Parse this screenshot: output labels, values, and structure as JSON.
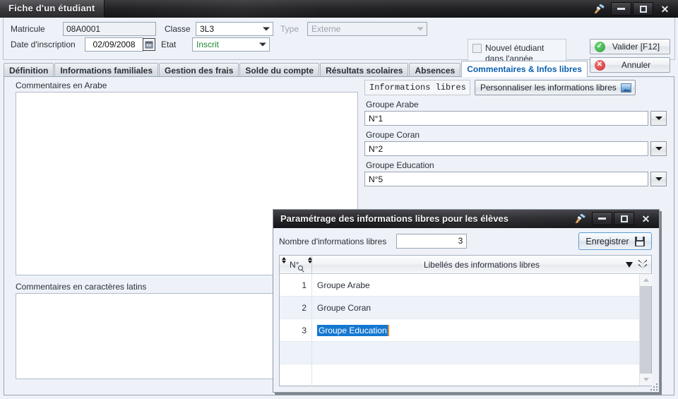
{
  "window": {
    "title": "Fiche d'un étudiant",
    "buttons": {
      "brush": "brush-icon",
      "minimize": "–",
      "maximize": "□",
      "close": "✕"
    }
  },
  "header_form": {
    "matricule_label": "Matricule",
    "matricule_value": "08A0001",
    "classe_label": "Classe",
    "classe_value": "3L3",
    "type_label": "Type",
    "type_value": "Externe",
    "date_label": "Date d'inscription",
    "date_value": "02/09/2008",
    "etat_label": "Etat",
    "etat_value": "Inscrit",
    "etat_color": "#1a8a2e",
    "checkbox_label": "Nouvel étudiant dans l'année courante",
    "valider_label": "Valider [F12]",
    "annuler_label": "Annuler"
  },
  "tabs": [
    {
      "label": "Définition",
      "active": false
    },
    {
      "label": "Informations familiales",
      "active": false
    },
    {
      "label": "Gestion des frais",
      "active": false
    },
    {
      "label": "Solde du compte",
      "active": false
    },
    {
      "label": "Résultats scolaires",
      "active": false
    },
    {
      "label": "Absences",
      "active": false
    },
    {
      "label": "Commentaires & Infos libres",
      "active": true
    }
  ],
  "left_panel": {
    "arabic_label": "Commentaires en Arabe",
    "arabic_value": "",
    "latin_label": "Commentaires en caractères latins",
    "latin_value": ""
  },
  "right_panel": {
    "section_title": "Informations libres",
    "customize_button": "Personnaliser les informations libres",
    "fields": [
      {
        "label": "Groupe Arabe",
        "value": "N°1"
      },
      {
        "label": "Groupe Coran",
        "value": "N°2"
      },
      {
        "label": "Groupe Education",
        "value": "N°5"
      }
    ]
  },
  "modal": {
    "title": "Paramétrage des informations libres pour les élèves",
    "count_label": "Nombre d'informations libres",
    "count_value": "3",
    "save_label": "Enregistrer",
    "columns": {
      "num": "N°",
      "label": "Libellés des informations libres"
    },
    "rows": [
      {
        "num": "1",
        "label": "Groupe Arabe",
        "selected": false
      },
      {
        "num": "2",
        "label": "Groupe Coran",
        "selected": false
      },
      {
        "num": "3",
        "label": "Groupe Education",
        "selected": true
      },
      {
        "num": "",
        "label": "",
        "selected": false
      },
      {
        "num": "",
        "label": "",
        "selected": false
      }
    ]
  },
  "colors": {
    "accent_blue": "#0b5fb0",
    "selection_blue": "#1477d1",
    "success_green": "#2b9e3a",
    "error_red": "#cf2626",
    "panel_bg": "#eef2f8"
  }
}
